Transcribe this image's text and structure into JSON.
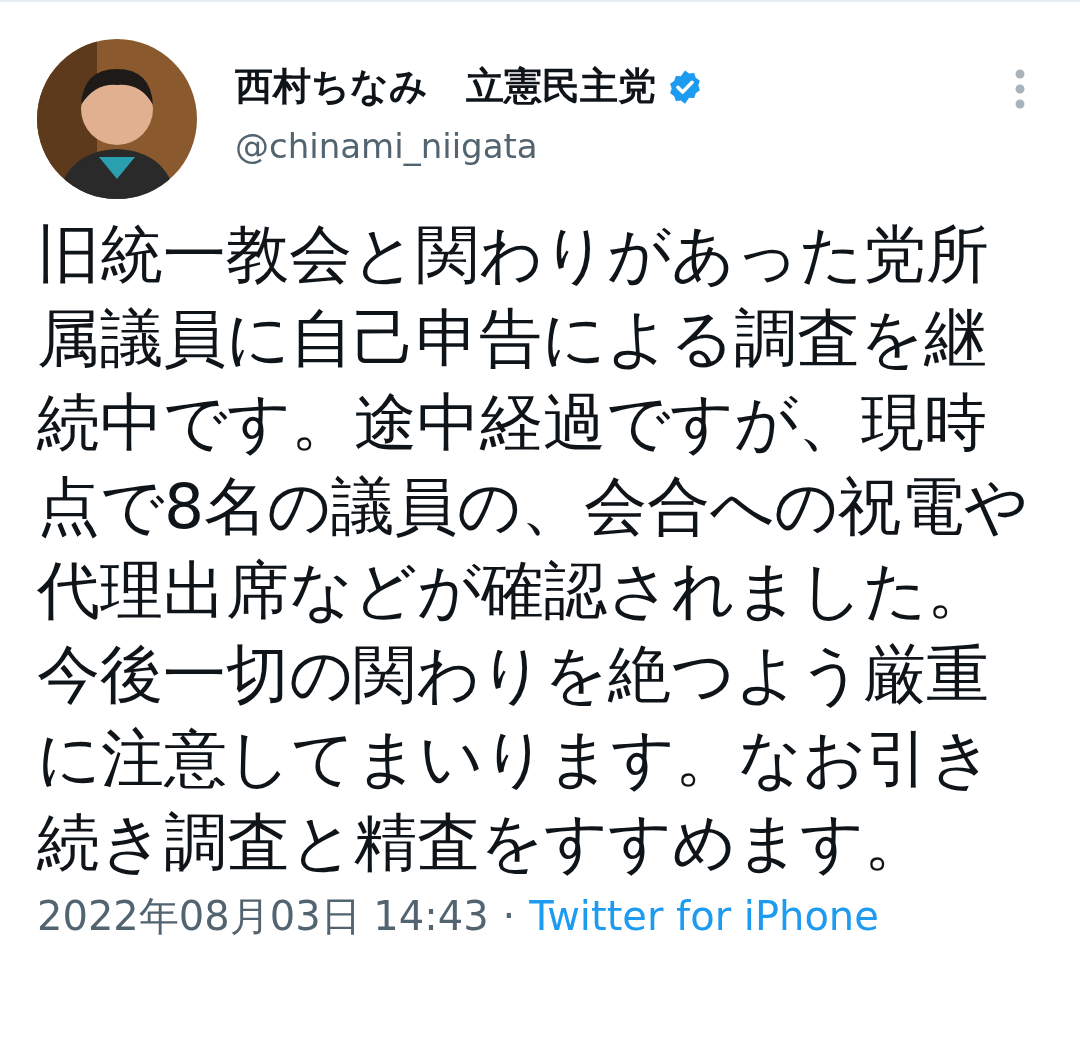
{
  "tweet": {
    "author": {
      "name": "西村ちなみ　立憲民主党",
      "verified": true,
      "handle": "@chinami_niigata"
    },
    "text": "旧統一教会と関わりがあった党所属議員に自己申告による調査を継続中です。途中経過ですが、現時点で8名の議員の、会合への祝電や代理出席などが確認されました。今後一切の関わりを絶つよう厳重に注意してまいります。なお引き続き調査と精査をすすめます。",
    "timestamp": "2022年08月03日 14:43",
    "separator": "·",
    "source": "Twitter for iPhone"
  }
}
